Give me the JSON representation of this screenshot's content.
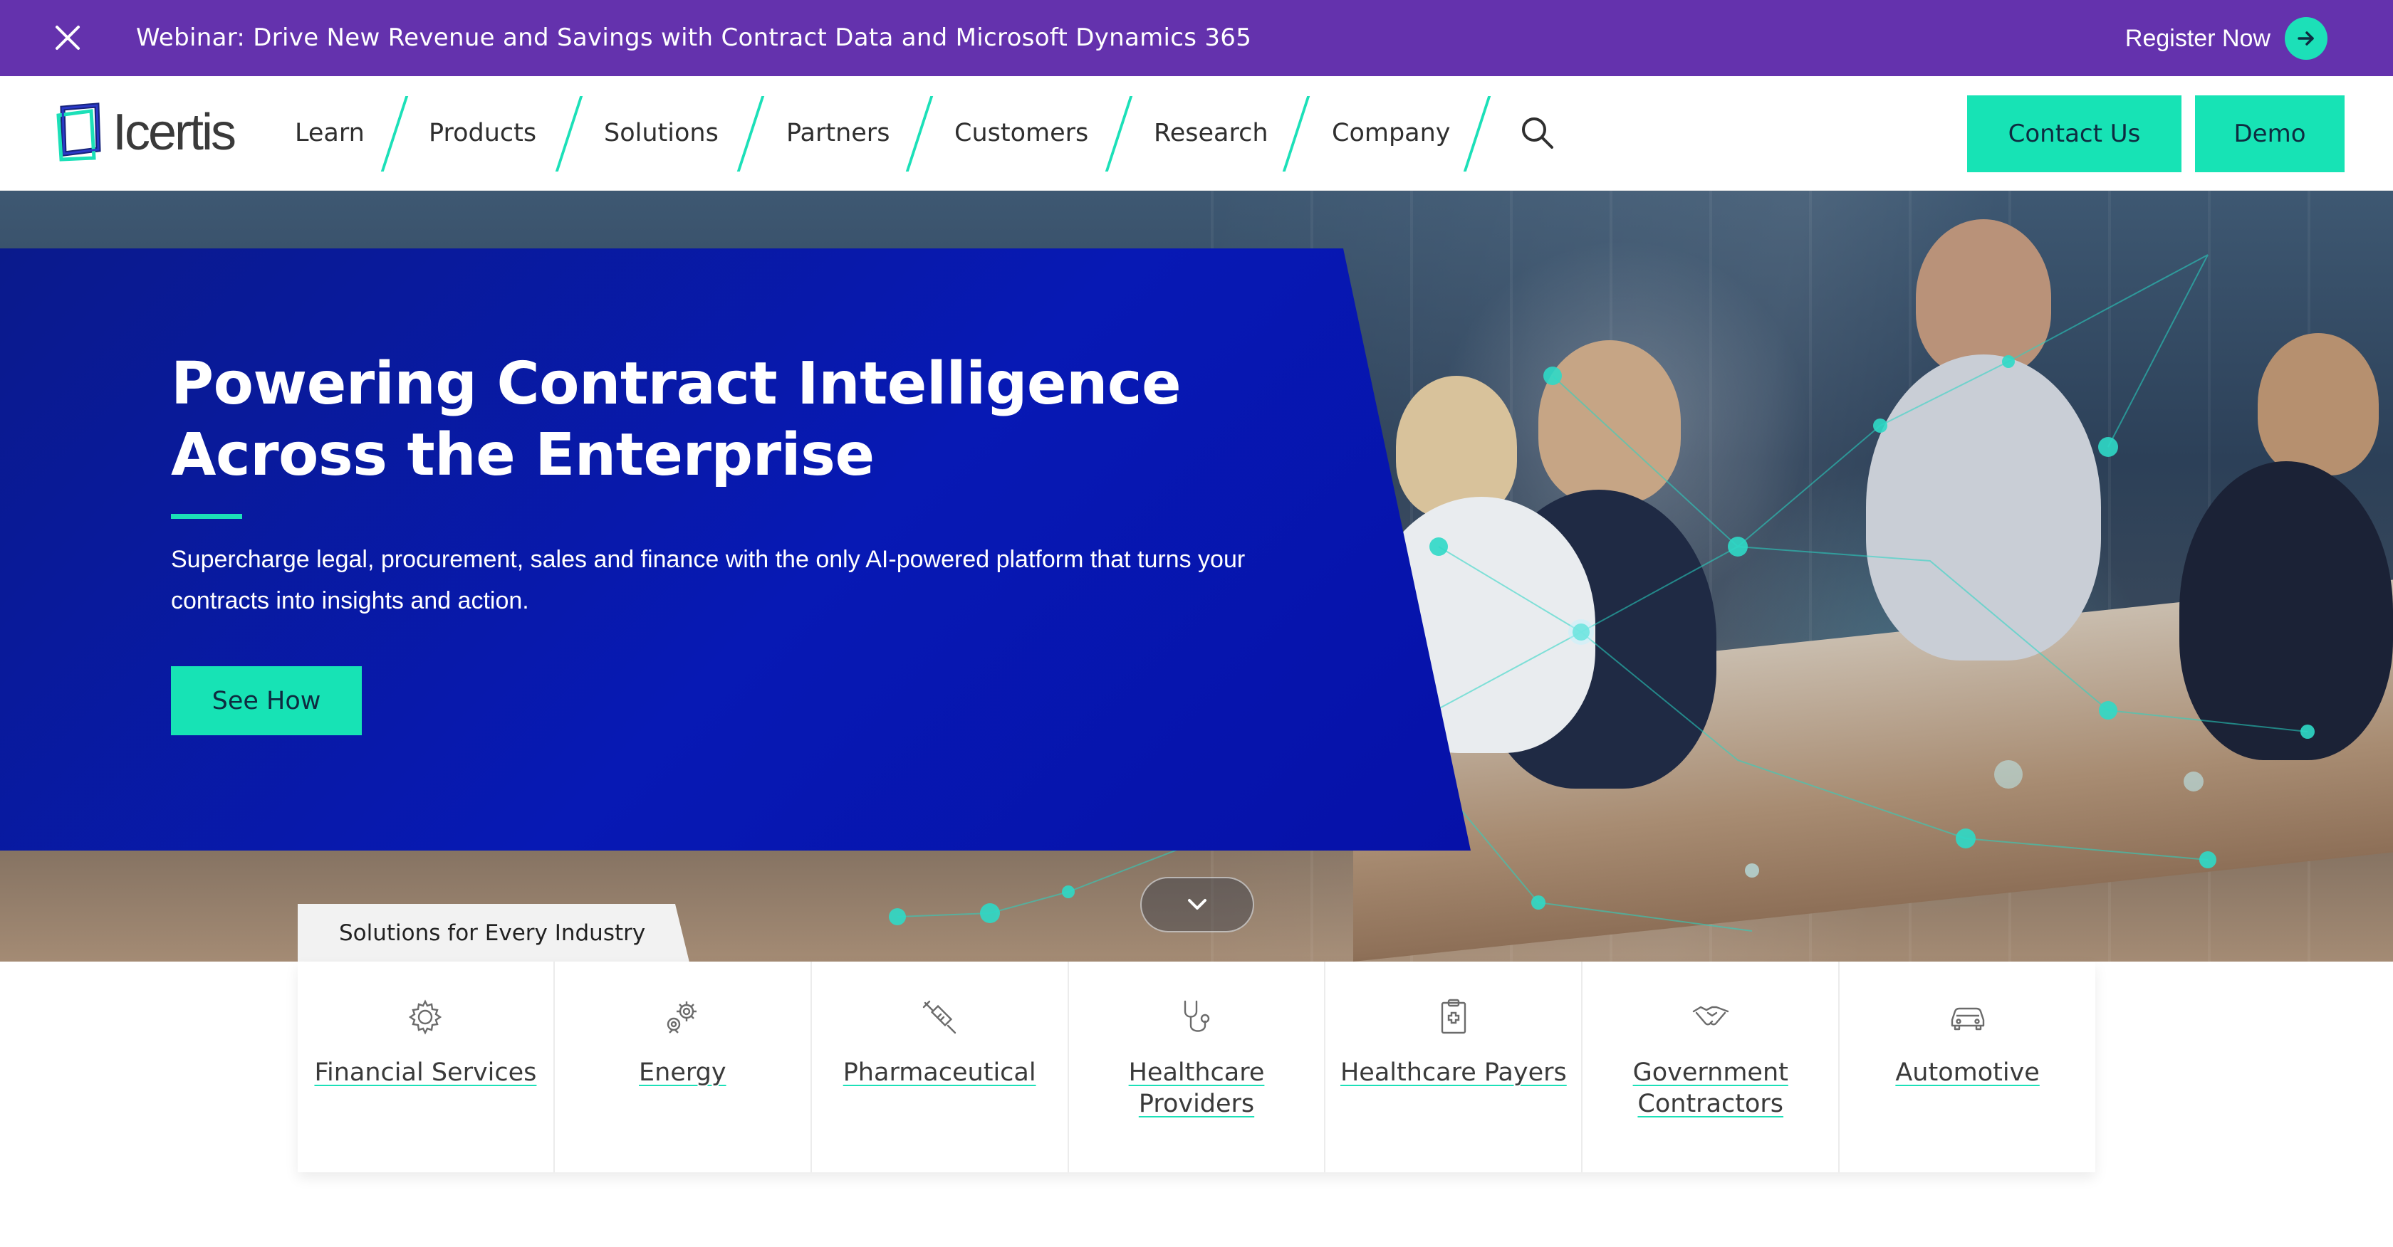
{
  "announcement": {
    "message": "Webinar: Drive New Revenue and Savings with Contract Data and Microsoft Dynamics 365",
    "cta_label": "Register Now"
  },
  "header": {
    "logo_text": "Icertis",
    "nav": [
      "Learn",
      "Products",
      "Solutions",
      "Partners",
      "Customers",
      "Research",
      "Company"
    ],
    "contact_label": "Contact Us",
    "demo_label": "Demo"
  },
  "hero": {
    "title_line1": "Powering Contract Intelligence",
    "title_line2": "Across the Enterprise",
    "subtitle": "Supercharge legal, procurement, sales and finance with the only AI-powered platform that turns your contracts into insights and action.",
    "cta_label": "See How"
  },
  "industries": {
    "tab_label": "Solutions for Every Industry",
    "items": [
      {
        "label": "Financial Services",
        "icon": "gear-icon"
      },
      {
        "label": "Energy",
        "icon": "energy-gears-icon"
      },
      {
        "label": "Pharmaceutical",
        "icon": "syringe-icon"
      },
      {
        "label": "Healthcare Providers",
        "icon": "stethoscope-icon"
      },
      {
        "label": "Healthcare Payers",
        "icon": "medical-clipboard-icon"
      },
      {
        "label": "Government Contractors",
        "icon": "handshake-icon"
      },
      {
        "label": "Automotive",
        "icon": "car-icon"
      }
    ]
  },
  "colors": {
    "announcement_bg": "#6432ad",
    "accent": "#17e3b5",
    "hero_panel": "#0719b4"
  }
}
